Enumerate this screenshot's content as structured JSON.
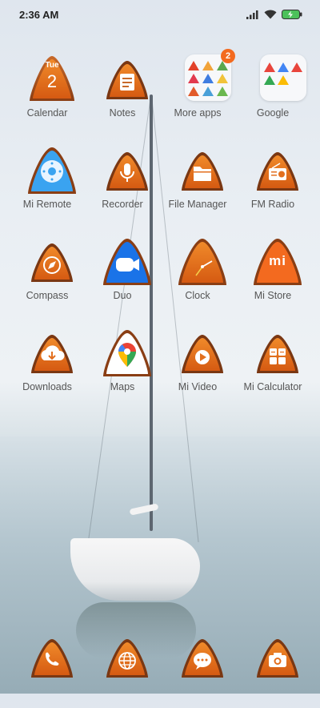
{
  "status_bar": {
    "time": "2:36 AM",
    "signal_icon": "signal-icon",
    "wifi_icon": "wifi-icon",
    "battery_icon": "battery-charging-icon"
  },
  "calendar": {
    "day": "Tue",
    "date": "2"
  },
  "apps": [
    {
      "label": "Calendar"
    },
    {
      "label": "Notes"
    },
    {
      "label": "More apps",
      "badge": "2"
    },
    {
      "label": "Google"
    },
    {
      "label": "Mi Remote"
    },
    {
      "label": "Recorder"
    },
    {
      "label": "File Manager"
    },
    {
      "label": "FM Radio"
    },
    {
      "label": "Compass"
    },
    {
      "label": "Duo"
    },
    {
      "label": "Clock"
    },
    {
      "label": "Mi Store"
    },
    {
      "label": "Downloads"
    },
    {
      "label": "Maps"
    },
    {
      "label": "Mi Video"
    },
    {
      "label": "Mi Calculator"
    }
  ],
  "mi_store_logo": "mi",
  "dock": [
    {
      "icon": "phone-icon"
    },
    {
      "icon": "browser-icon"
    },
    {
      "icon": "messaging-icon"
    },
    {
      "icon": "camera-icon"
    }
  ],
  "colors": {
    "theme_brown": "#9a4a1c",
    "theme_orange": "#e36f1e",
    "badge": "#f36a1f",
    "label": "#555555"
  }
}
